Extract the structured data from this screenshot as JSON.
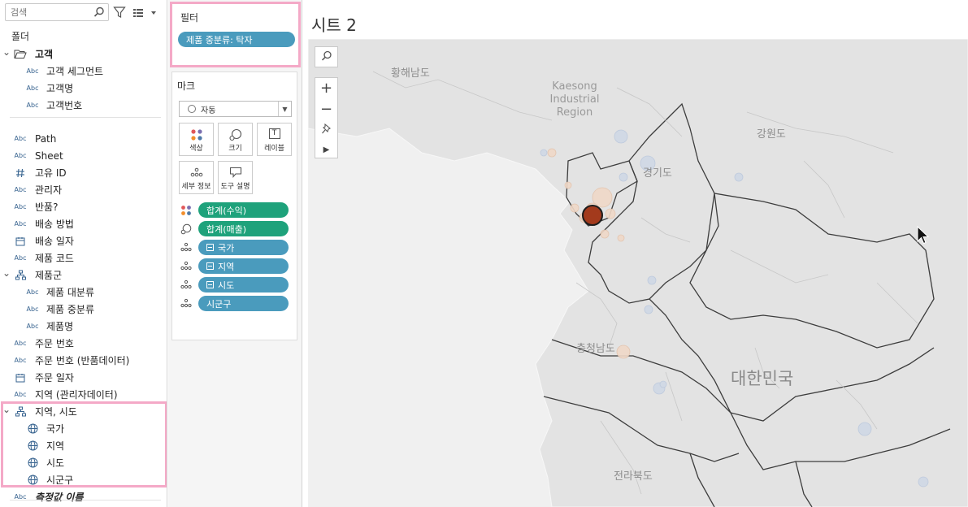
{
  "data_pane": {
    "search_placeholder": "검색",
    "folder_label": "폴더",
    "fields": [
      {
        "label": "고객",
        "type": "folder",
        "caret": "⌄",
        "bold": true
      },
      {
        "label": "고객 세그먼트",
        "type": "abc",
        "indent": 1
      },
      {
        "label": "고객명",
        "type": "abc",
        "indent": 1
      },
      {
        "label": "고객번호",
        "type": "abc",
        "indent": 1
      },
      {
        "label": "Path",
        "type": "abc"
      },
      {
        "label": "Sheet",
        "type": "abc"
      },
      {
        "label": "고유 ID",
        "type": "num"
      },
      {
        "label": "관리자",
        "type": "abc"
      },
      {
        "label": "반품?",
        "type": "abc"
      },
      {
        "label": "배송 방법",
        "type": "abc"
      },
      {
        "label": "배송 일자",
        "type": "date"
      },
      {
        "label": "제품 코드",
        "type": "abc"
      },
      {
        "label": "제품군",
        "type": "hier",
        "caret": "⌄"
      },
      {
        "label": "제품 대분류",
        "type": "abc",
        "indent": 1
      },
      {
        "label": "제품 중분류",
        "type": "abc",
        "indent": 1
      },
      {
        "label": "제품명",
        "type": "abc",
        "indent": 1
      },
      {
        "label": "주문 번호",
        "type": "abc"
      },
      {
        "label": "주문 번호 (반품데이터)",
        "type": "abc"
      },
      {
        "label": "주문 일자",
        "type": "date"
      },
      {
        "label": "지역 (관리자데이터)",
        "type": "abc"
      },
      {
        "label": "지역, 시도",
        "type": "hier",
        "caret": "⌄"
      },
      {
        "label": "국가",
        "type": "geo",
        "indent": 1
      },
      {
        "label": "지역",
        "type": "geo",
        "indent": 1
      },
      {
        "label": "시도",
        "type": "geo",
        "indent": 1
      },
      {
        "label": "시군구",
        "type": "geo",
        "indent": 1
      },
      {
        "label": "측정값 이름",
        "type": "abc",
        "italic": true
      }
    ],
    "abc_text": "Abc"
  },
  "filters": {
    "title": "필터",
    "pills": [
      "제품 중분류: 탁자"
    ]
  },
  "marks": {
    "title": "마크",
    "mark_type": "자동",
    "buttons": {
      "color": "색상",
      "size": "크기",
      "label": "레이블",
      "detail": "세부 정보",
      "tooltip": "도구 설명"
    },
    "label_glyph": "T",
    "pills": [
      {
        "text": "합계(수익)",
        "color": "green",
        "icon": "color-icon"
      },
      {
        "text": "합계(매출)",
        "color": "green",
        "icon": "size-icon"
      },
      {
        "text": "국가",
        "color": "blue",
        "icon": "detail-icon",
        "minus": true
      },
      {
        "text": "지역",
        "color": "blue",
        "icon": "detail-icon",
        "minus": true
      },
      {
        "text": "시도",
        "color": "blue",
        "icon": "detail-icon",
        "minus": true
      },
      {
        "text": "시군구",
        "color": "blue",
        "icon": "detail-icon"
      }
    ]
  },
  "sheet": {
    "title": "시트 2",
    "map_labels": {
      "hwanghae": "황해남도",
      "kaesong_1": "Kaesong",
      "kaesong_2": "Industrial",
      "kaesong_3": "Region",
      "gangwon": "강원도",
      "gyeonggi": "경기도",
      "chungnam": "충청남도",
      "korea": "대한민국",
      "jeonbuk": "전라북도"
    },
    "tools": {
      "zoom_in": "+",
      "zoom_out": "−",
      "play": "▶"
    }
  },
  "colors": {
    "accent_blue": "#4a9bbd",
    "accent_green": "#1ea27b",
    "highlight_pink": "#f4a9c7",
    "selected_mark": "#a33a1c"
  }
}
